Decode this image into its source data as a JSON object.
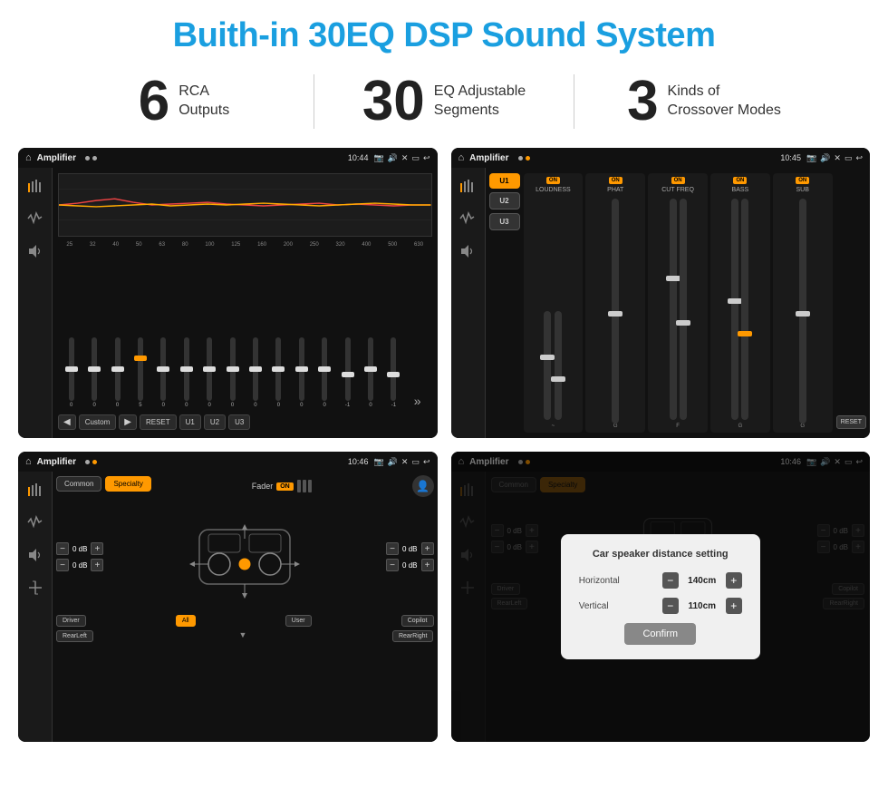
{
  "title": "Buith-in 30EQ DSP Sound System",
  "stats": [
    {
      "number": "6",
      "label": "RCA\nOutputs"
    },
    {
      "number": "30",
      "label": "EQ Adjustable\nSegments"
    },
    {
      "number": "3",
      "label": "Kinds of\nCrossover Modes"
    }
  ],
  "screens": [
    {
      "id": "eq-screen",
      "statusBar": {
        "title": "Amplifier",
        "time": "10:44"
      },
      "freqLabels": [
        "25",
        "32",
        "40",
        "50",
        "63",
        "80",
        "100",
        "125",
        "160",
        "200",
        "250",
        "320",
        "400",
        "500",
        "630"
      ],
      "sliderValues": [
        "0",
        "0",
        "0",
        "5",
        "0",
        "0",
        "0",
        "0",
        "0",
        "0",
        "0",
        "0",
        "-1",
        "0",
        "-1"
      ],
      "bottomBtns": [
        "Custom",
        "RESET",
        "U1",
        "U2",
        "U3"
      ]
    },
    {
      "id": "amp2-screen",
      "statusBar": {
        "title": "Amplifier",
        "time": "10:45"
      },
      "presets": [
        "U1",
        "U2",
        "U3"
      ],
      "channels": [
        {
          "name": "LOUDNESS",
          "on": true
        },
        {
          "name": "PHAT",
          "on": true
        },
        {
          "name": "CUT FREQ",
          "on": true
        },
        {
          "name": "BASS",
          "on": true
        },
        {
          "name": "SUB",
          "on": true
        }
      ],
      "resetBtn": "RESET"
    },
    {
      "id": "crossover-screen",
      "statusBar": {
        "title": "Amplifier",
        "time": "10:46"
      },
      "tabs": [
        "Common",
        "Specialty"
      ],
      "faderLabel": "Fader",
      "faderOn": "ON",
      "channelValues": [
        "0 dB",
        "0 dB",
        "0 dB",
        "0 dB"
      ],
      "bottomLabels": [
        "Driver",
        "All",
        "User",
        "Copilot",
        "RearLeft",
        "RearRight"
      ]
    },
    {
      "id": "dialog-screen",
      "statusBar": {
        "title": "Amplifier",
        "time": "10:46"
      },
      "tabs": [
        "Common",
        "Specialty"
      ],
      "dialog": {
        "title": "Car speaker distance setting",
        "horizontalLabel": "Horizontal",
        "horizontalValue": "140cm",
        "verticalLabel": "Vertical",
        "verticalValue": "110cm",
        "confirmLabel": "Confirm"
      },
      "channelValues": [
        "0 dB",
        "0 dB"
      ],
      "bottomLabels": [
        "Driver",
        "Copilot",
        "RearLeft",
        "RearRight"
      ]
    }
  ]
}
